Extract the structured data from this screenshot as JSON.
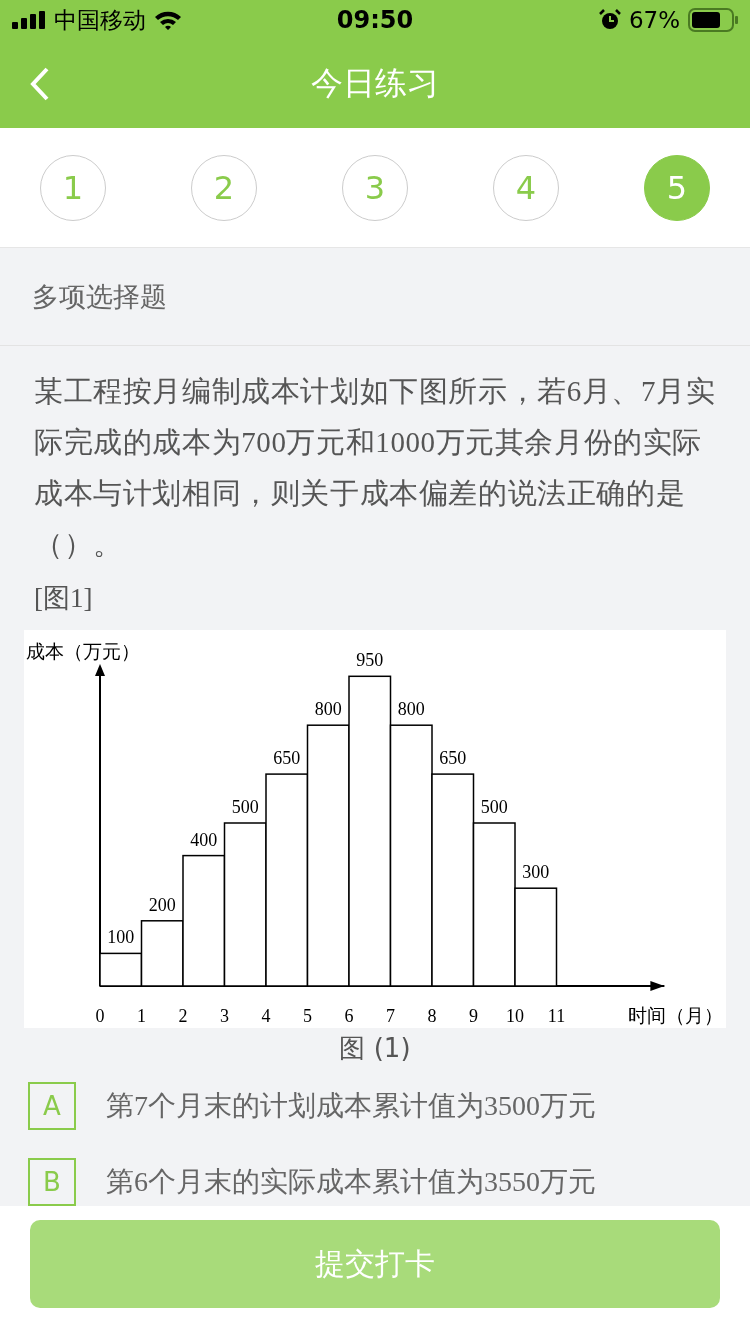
{
  "status_bar": {
    "carrier": "中国移动",
    "time": "09:50",
    "battery": "67%"
  },
  "nav": {
    "title": "今日练习"
  },
  "steps": [
    {
      "label": "1",
      "selected": false
    },
    {
      "label": "2",
      "selected": false
    },
    {
      "label": "3",
      "selected": false
    },
    {
      "label": "4",
      "selected": false
    },
    {
      "label": "5",
      "selected": true
    }
  ],
  "section": "多项选择题",
  "question": "某工程按月编制成本计划如下图所示，若6月、7月实际完成的成本为700万元和1000万元其余月份的实际成本与计划相同，则关于成本偏差的说法正确的是（）。",
  "figure_ref": "[图1]",
  "figure": {
    "chart_data": {
      "type": "bar",
      "ylabel": "成本（万元）",
      "xlabel": "时间（月）",
      "xlim": [
        0,
        13.6
      ],
      "x": [
        0.5,
        1.5,
        2.5,
        3.5,
        4.5,
        5.5,
        6.5,
        7.5,
        8.5,
        9.5,
        10.5
      ],
      "xticks": [
        {
          "value": 0,
          "label": "0"
        },
        {
          "value": 1,
          "label": "1"
        },
        {
          "value": 2,
          "label": "2"
        },
        {
          "value": 3,
          "label": "3"
        },
        {
          "value": 4,
          "label": "4"
        },
        {
          "value": 5,
          "label": "5"
        },
        {
          "value": 6,
          "label": "6"
        },
        {
          "value": 7,
          "label": "7"
        },
        {
          "value": 8,
          "label": "8"
        },
        {
          "value": 9,
          "label": "9"
        },
        {
          "value": 10,
          "label": "10"
        },
        {
          "value": 11,
          "label": "11"
        }
      ],
      "values": [
        100,
        200,
        400,
        500,
        650,
        800,
        950,
        800,
        650,
        500,
        300
      ],
      "data_labels": true
    },
    "caption": "图 (1)"
  },
  "options": [
    {
      "letter": "A",
      "text": "第7个月末的计划成本累计值为3500万元",
      "selected": false
    },
    {
      "letter": "B",
      "text": "第6个月末的实际成本累计值为3550万元",
      "selected": false
    }
  ],
  "submit": "提交打卡"
}
